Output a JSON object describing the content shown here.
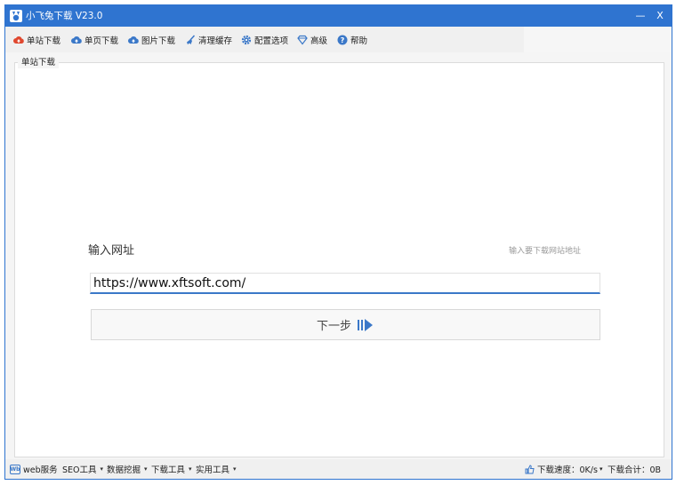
{
  "window": {
    "title": "小飞兔下载 V23.0",
    "minimize_label": "—",
    "close_label": "X"
  },
  "toolbar": {
    "items": [
      {
        "label": "单站下载",
        "icon": "cloud-upload-red-icon"
      },
      {
        "label": "单页下载",
        "icon": "cloud-upload-blue-icon"
      },
      {
        "label": "图片下载",
        "icon": "cloud-upload-blue-icon"
      },
      {
        "label": "清理缓存",
        "icon": "broom-icon"
      },
      {
        "label": "配置选项",
        "icon": "gear-icon"
      },
      {
        "label": "高级",
        "icon": "diamond-icon"
      },
      {
        "label": "帮助",
        "icon": "help-icon"
      }
    ]
  },
  "panel": {
    "title": "单站下载"
  },
  "form": {
    "label": "输入网址",
    "hint": "输入要下载网站地址",
    "url_value": "https://www.xftsoft.com/",
    "next_label": "下一步"
  },
  "statusbar": {
    "web_badge": "Wb",
    "items": [
      {
        "label": "web服务"
      },
      {
        "label": "SEO工具"
      },
      {
        "label": "数据挖掘"
      },
      {
        "label": "下载工具"
      },
      {
        "label": "实用工具"
      }
    ],
    "caret": "▾",
    "speed": "下载速度：0K/s",
    "separator": "▾",
    "total": "下载合计：0B"
  },
  "colors": {
    "accent": "#2f74d0",
    "red_icon": "#e0482f",
    "blue_icon": "#3b78c8",
    "input_underline": "#3b78c8"
  }
}
